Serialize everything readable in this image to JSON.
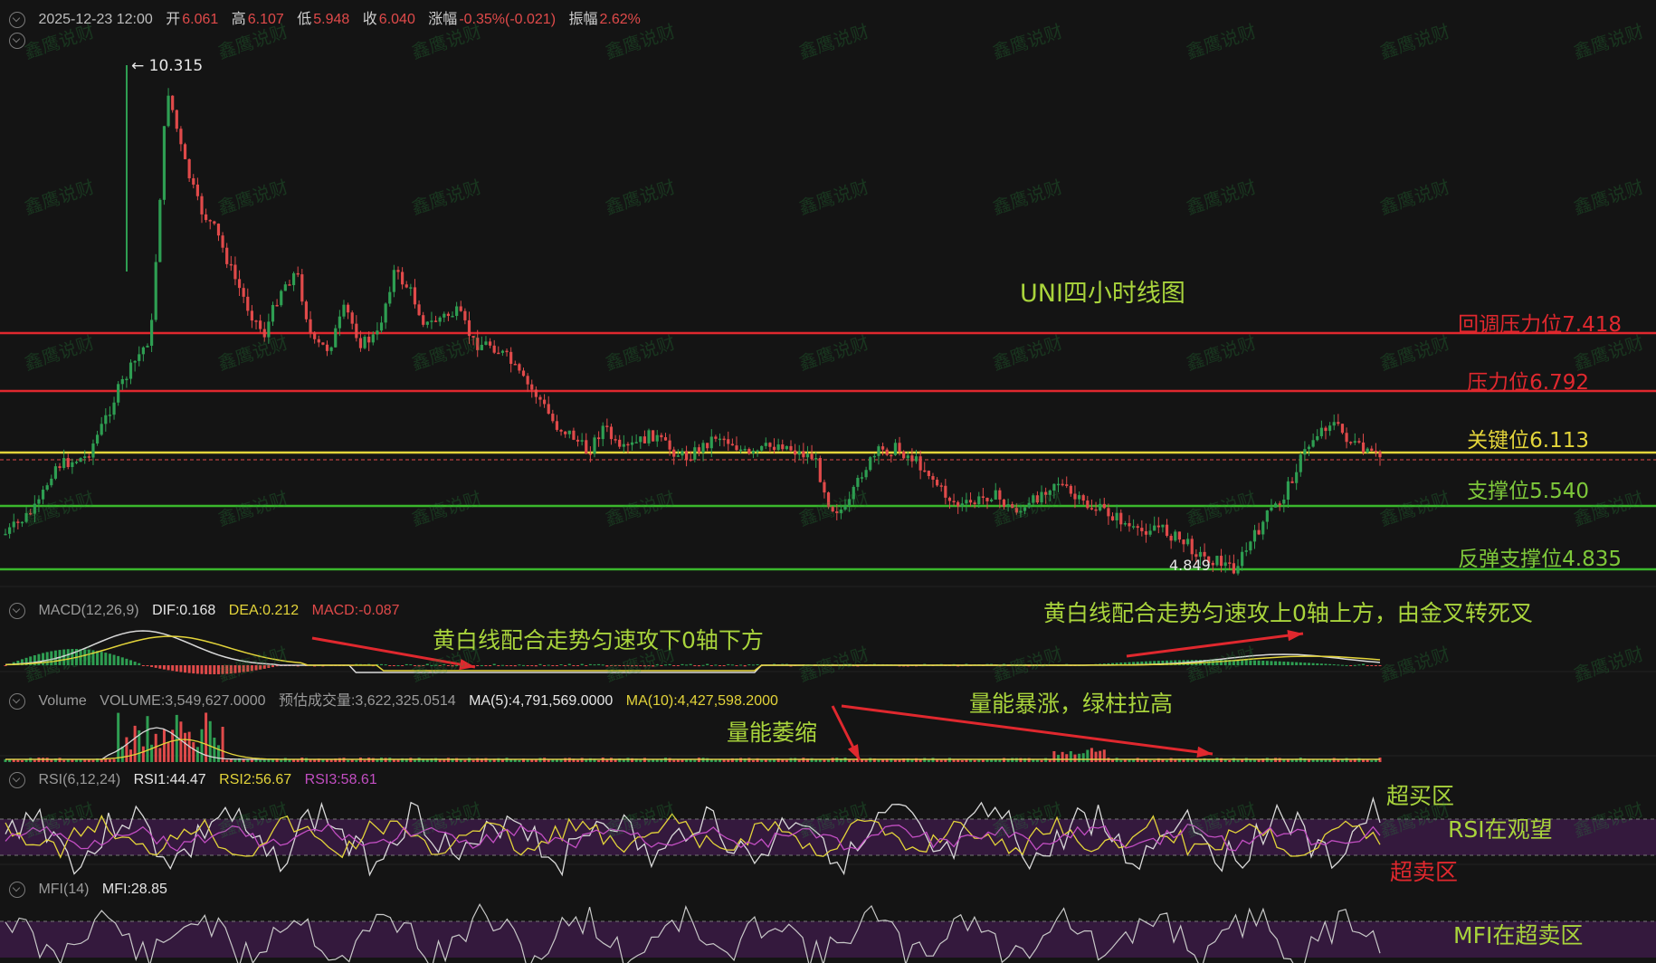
{
  "colors": {
    "up": "#2e9e52",
    "down": "#e04a4a",
    "resistance": "#e0282e",
    "key": "#e3d43a",
    "support": "#3ab82c",
    "white_line": "#d8d8d8",
    "yellow_line": "#e3d43a",
    "magenta": "#c24ec2",
    "band": "#3a1a44"
  },
  "header": {
    "row1": {
      "date": "2025-12-23 12:00",
      "open_label": "开",
      "open": "6.061",
      "high_label": "高",
      "high": "6.107",
      "low_label": "低",
      "low": "5.948",
      "close_label": "收",
      "close": "6.040",
      "change_label": "涨幅",
      "change": "-0.35%(-0.021)",
      "amp_label": "振幅",
      "amp": "2.62%"
    }
  },
  "main": {
    "title": "UNI四小时线图",
    "peak_label": "← 10.315",
    "low_label": "4.849",
    "levels": [
      {
        "label": "回调压力位7.418",
        "value": 7.418,
        "color": "#e0282e",
        "text_color": "#e0282e"
      },
      {
        "label": "压力位6.792",
        "value": 6.792,
        "color": "#e0282e",
        "text_color": "#e0282e"
      },
      {
        "label": "关键位6.113",
        "value": 6.113,
        "color": "#e3d43a",
        "text_color": "#e3d43a"
      },
      {
        "label": "支撑位5.540",
        "value": 5.54,
        "color": "#3ab82c",
        "text_color": "#7ec83a"
      },
      {
        "label": "反弹支撑位4.835",
        "value": 4.835,
        "color": "#3ab82c",
        "text_color": "#7ec83a"
      }
    ]
  },
  "macd": {
    "name": "MACD(12,26,9)",
    "dif": "DIF:0.168",
    "dea": "DEA:0.212",
    "macd": "MACD:-0.087",
    "note_left": "黄白线配合走势匀速攻下0轴下方",
    "note_right": "黄白线配合走势匀速攻上0轴上方，由金叉转死叉"
  },
  "volume": {
    "name": "Volume",
    "vol": "VOLUME:3,549,627.0000",
    "est": "预估成交量:3,622,325.0514",
    "ma5": "MA(5):4,791,569.0000",
    "ma10": "MA(10):4,427,598.2000",
    "note_shrink": "量能萎缩",
    "note_surge": "量能暴涨，绿柱拉高"
  },
  "rsi": {
    "name": "RSI(6,12,24)",
    "rsi1": "RSI1:44.47",
    "rsi2": "RSI2:56.67",
    "rsi3": "RSI3:58.61",
    "overbought": "超买区",
    "observe": "RSI在观望",
    "oversold": "超卖区"
  },
  "mfi": {
    "name": "MFI(14)",
    "value": "MFI:28.85",
    "note": "MFI在超卖区"
  },
  "watermark": "鑫鹰说财",
  "chart_data": [
    {
      "type": "candlestick",
      "title": "UNI四小时线图",
      "peak": 10.315,
      "low": 4.849,
      "close_series": [
        5.3,
        5.5,
        5.7,
        5.9,
        5.85,
        5.95,
        6.2,
        6.6,
        7.0,
        7.3,
        9.2,
        9.6,
        9.0,
        8.8,
        8.2,
        7.6,
        7.4,
        7.7,
        7.8,
        7.3,
        7.2,
        7.5,
        7.1,
        7.2,
        7.8,
        7.7,
        7.4,
        7.5,
        7.6,
        7.3,
        7.2,
        7.1,
        6.9,
        6.7,
        6.3,
        6.35,
        6.25,
        6.3,
        6.2,
        6.3,
        6.35,
        6.3,
        6.25,
        6.3,
        6.35,
        6.3,
        6.2,
        6.25,
        6.3,
        6.2,
        6.15,
        5.6,
        5.5,
        5.8,
        6.05,
        6.1,
        6.05,
        5.9,
        5.7,
        5.6,
        5.65,
        5.7,
        5.6,
        5.55,
        5.75,
        5.85,
        5.7,
        5.6,
        5.55,
        5.5,
        5.35,
        5.4,
        5.3,
        5.2,
        5.0,
        4.95,
        4.85,
        5.05,
        5.3,
        5.5,
        6.0,
        6.3,
        6.45,
        6.2,
        6.1,
        6.05
      ],
      "levels": [
        7.418,
        6.792,
        6.113,
        5.54,
        4.835
      ]
    },
    {
      "type": "line",
      "name": "MACD",
      "dif": 0.168,
      "dea": 0.212,
      "macd": -0.087
    },
    {
      "type": "bar",
      "name": "Volume",
      "volume": 3549627.0,
      "ma5": 4791569.0,
      "ma10": 4427598.2
    },
    {
      "type": "line",
      "name": "RSI",
      "rsi1": 44.47,
      "rsi2": 56.67,
      "rsi3": 58.61
    },
    {
      "type": "line",
      "name": "MFI",
      "mfi": 28.85
    }
  ]
}
